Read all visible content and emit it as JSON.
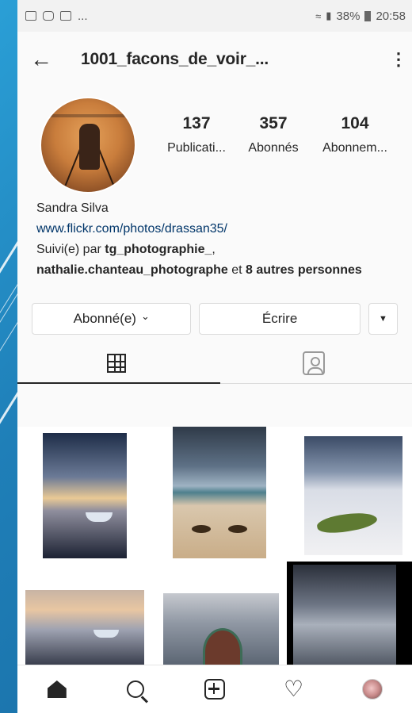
{
  "status_bar": {
    "left_more": "...",
    "battery_pct": "38%",
    "time": "20:58"
  },
  "header": {
    "title": "1001_facons_de_voir_...",
    "back_icon": "arrow-left-icon",
    "more_icon": "more-vertical-icon"
  },
  "stats": [
    {
      "num": "137",
      "label": "Publicati..."
    },
    {
      "num": "357",
      "label": "Abonnés"
    },
    {
      "num": "104",
      "label": "Abonnem..."
    }
  ],
  "bio": {
    "name": "Sandra Silva",
    "link": "www.flickr.com/photos/drassan35/",
    "followed_prefix": "Suivi(e) par ",
    "followed_user1": "tg_photographie_",
    "followed_sep": ",",
    "followed_user2": "nathalie.chanteau_photographe",
    "followed_and": " et ",
    "followed_others": "8 autres personnes"
  },
  "actions": {
    "follow_label": "Abonné(e)",
    "follow_chevron": "⌄",
    "write_label": "Écrire",
    "drop_label": "▼"
  },
  "tabs": [
    {
      "icon": "grid-icon",
      "active": true
    },
    {
      "icon": "tagged-icon",
      "active": false
    }
  ],
  "bottom_nav": [
    "home-icon",
    "search-icon",
    "add-icon",
    "heart-icon",
    "profile-icon"
  ],
  "colors": {
    "link": "#003569",
    "text": "#262626",
    "background": "#fafafa"
  }
}
